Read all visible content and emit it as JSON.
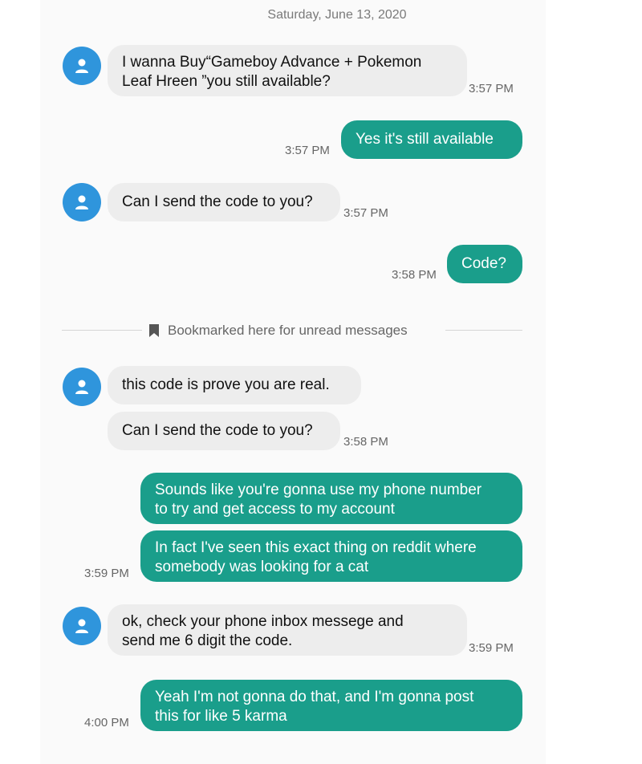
{
  "header": {
    "date": "Saturday, June 13, 2020"
  },
  "colors": {
    "incoming_bubble": "#ededed",
    "outgoing_bubble": "#1a9e8b",
    "avatar": "#2f95dc"
  },
  "divider": {
    "label": "Bookmarked here for unread messages",
    "icon": "bookmark-icon"
  },
  "messages": [
    {
      "direction": "incoming",
      "lines": [
        "I wanna Buy“Gameboy Advance + Pokemon",
        "Leaf Hreen ”you still available?"
      ],
      "time": "3:57 PM"
    },
    {
      "direction": "outgoing",
      "lines": [
        "Yes it's still available"
      ],
      "time": "3:57 PM"
    },
    {
      "direction": "incoming",
      "lines": [
        "Can I send the code to you?"
      ],
      "time": "3:57 PM"
    },
    {
      "direction": "outgoing",
      "lines": [
        "Code?"
      ],
      "time": "3:58 PM"
    },
    {
      "direction": "incoming",
      "lines": [
        "this code is prove you are real."
      ]
    },
    {
      "direction": "incoming",
      "lines": [
        "Can I send the code to you?"
      ],
      "time": "3:58 PM"
    },
    {
      "direction": "outgoing",
      "lines": [
        "Sounds like you're gonna use my phone number",
        "to try and get access to my account"
      ]
    },
    {
      "direction": "outgoing",
      "lines": [
        "In fact I've seen this exact thing on reddit where",
        "somebody was looking for a cat"
      ],
      "time": "3:59 PM"
    },
    {
      "direction": "incoming",
      "lines": [
        "ok, check your phone inbox messege and",
        "send me 6 digit the code."
      ],
      "time": "3:59 PM"
    },
    {
      "direction": "outgoing",
      "lines": [
        "Yeah I'm not gonna do that, and I'm gonna post",
        "this for like 5 karma"
      ],
      "time": "4:00 PM"
    }
  ]
}
